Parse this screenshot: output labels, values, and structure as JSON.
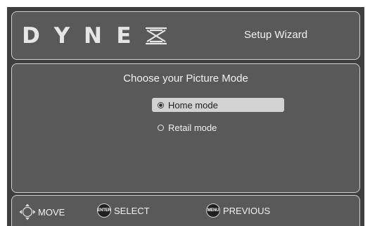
{
  "header": {
    "logo_text": "DYNEX",
    "title": "Setup Wizard"
  },
  "main": {
    "prompt": "Choose your Picture Mode",
    "options": [
      {
        "label": "Home mode",
        "selected": true
      },
      {
        "label": "Retail mode",
        "selected": false
      }
    ]
  },
  "footer": {
    "hints": [
      {
        "button": "",
        "label": "MOVE",
        "icon": "dpad-icon"
      },
      {
        "button": "ENTER",
        "label": "SELECT",
        "icon": "enter-button-icon"
      },
      {
        "button": "MENU",
        "label": "PREVIOUS",
        "icon": "menu-button-icon"
      }
    ]
  },
  "colors": {
    "background": "#3f3f3f",
    "panel": "#595959",
    "selection": "#d2d2d2"
  }
}
